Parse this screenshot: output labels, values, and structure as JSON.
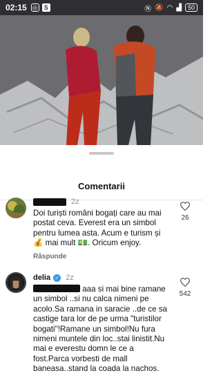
{
  "status_bar": {
    "time": "02:15",
    "battery": "50"
  },
  "sheet": {
    "title": "Comentarii"
  },
  "comments": [
    {
      "username_hidden": true,
      "time": "2z",
      "text": "Doi turiști români bogați care au mai postat ceva. Everest era un simbol pentru lumea asta. Acum e turism și 💰 mai mult 💵. Oricum enjoy.",
      "likes": "26",
      "reply_label": "Răspunde"
    },
    {
      "username": "delia",
      "verified": true,
      "time": "2z",
      "text": "aaa si mai bine ramane un simbol ..si nu calca nimeni pe acolo.Sa ramana in saracie ..de ce sa castige tara lor de pe urma \"turistilor bogati\"!Ramane un simbol!Nu fura nimeni muntele din loc..stai linistit.Nu mai e everestu domn le ce a fost.Parca vorbesti de mall baneasa..stand la coada la nachos.",
      "likes": "542"
    }
  ]
}
